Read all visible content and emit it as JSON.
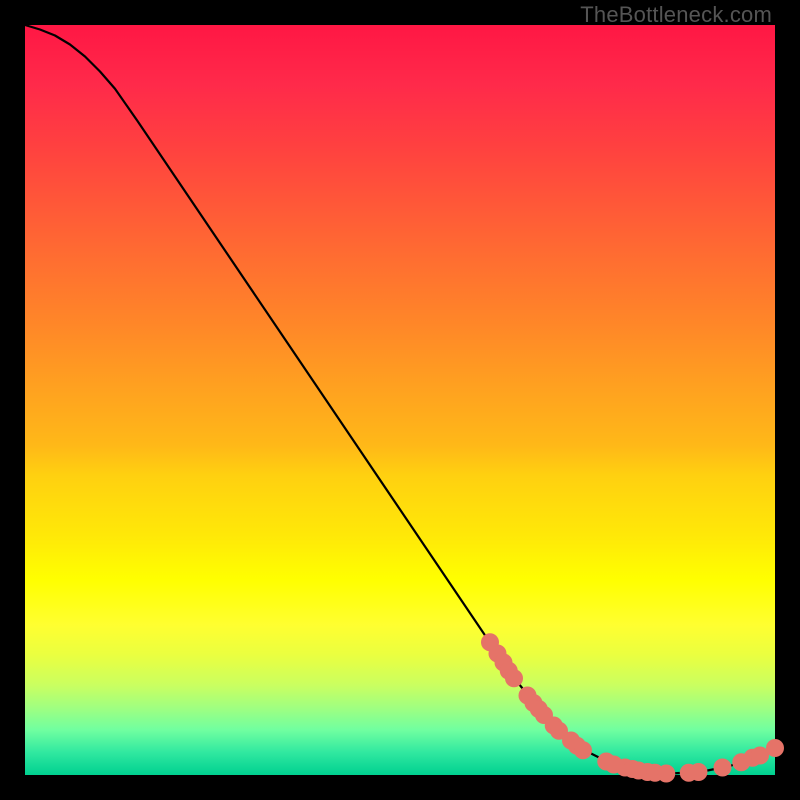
{
  "watermark": "TheBottleneck.com",
  "chart_data": {
    "type": "line",
    "title": "",
    "xlabel": "",
    "ylabel": "",
    "xlim": [
      0,
      100
    ],
    "ylim": [
      0,
      100
    ],
    "grid": false,
    "curve": [
      {
        "x": 0.0,
        "y": 100.0
      },
      {
        "x": 2.0,
        "y": 99.4
      },
      {
        "x": 4.0,
        "y": 98.6
      },
      {
        "x": 6.0,
        "y": 97.4
      },
      {
        "x": 8.0,
        "y": 95.8
      },
      {
        "x": 10.0,
        "y": 93.8
      },
      {
        "x": 12.0,
        "y": 91.5
      },
      {
        "x": 15.0,
        "y": 87.2
      },
      {
        "x": 20.0,
        "y": 79.8
      },
      {
        "x": 25.0,
        "y": 72.4
      },
      {
        "x": 30.0,
        "y": 65.0
      },
      {
        "x": 35.0,
        "y": 57.6
      },
      {
        "x": 40.0,
        "y": 50.2
      },
      {
        "x": 45.0,
        "y": 42.8
      },
      {
        "x": 50.0,
        "y": 35.4
      },
      {
        "x": 55.0,
        "y": 28.0
      },
      {
        "x": 60.0,
        "y": 20.6
      },
      {
        "x": 65.0,
        "y": 13.2
      },
      {
        "x": 70.0,
        "y": 7.0
      },
      {
        "x": 74.0,
        "y": 3.6
      },
      {
        "x": 78.0,
        "y": 1.6
      },
      {
        "x": 82.0,
        "y": 0.6
      },
      {
        "x": 86.0,
        "y": 0.2
      },
      {
        "x": 90.0,
        "y": 0.4
      },
      {
        "x": 94.0,
        "y": 1.2
      },
      {
        "x": 98.0,
        "y": 2.6
      },
      {
        "x": 100.0,
        "y": 3.6
      }
    ],
    "highlight_points": [
      {
        "x": 62.0,
        "y": 17.7
      },
      {
        "x": 63.0,
        "y": 16.2
      },
      {
        "x": 63.8,
        "y": 15.0
      },
      {
        "x": 64.5,
        "y": 13.9
      },
      {
        "x": 65.2,
        "y": 12.9
      },
      {
        "x": 67.0,
        "y": 10.6
      },
      {
        "x": 67.8,
        "y": 9.6
      },
      {
        "x": 68.5,
        "y": 8.8
      },
      {
        "x": 69.2,
        "y": 8.0
      },
      {
        "x": 70.5,
        "y": 6.6
      },
      {
        "x": 71.2,
        "y": 5.9
      },
      {
        "x": 72.8,
        "y": 4.6
      },
      {
        "x": 73.6,
        "y": 3.9
      },
      {
        "x": 74.4,
        "y": 3.3
      },
      {
        "x": 77.5,
        "y": 1.8
      },
      {
        "x": 78.5,
        "y": 1.4
      },
      {
        "x": 80.0,
        "y": 1.0
      },
      {
        "x": 81.0,
        "y": 0.8
      },
      {
        "x": 81.8,
        "y": 0.6
      },
      {
        "x": 83.0,
        "y": 0.4
      },
      {
        "x": 84.0,
        "y": 0.3
      },
      {
        "x": 85.5,
        "y": 0.2
      },
      {
        "x": 88.5,
        "y": 0.3
      },
      {
        "x": 89.8,
        "y": 0.4
      },
      {
        "x": 93.0,
        "y": 1.0
      },
      {
        "x": 95.5,
        "y": 1.7
      },
      {
        "x": 97.0,
        "y": 2.3
      },
      {
        "x": 98.0,
        "y": 2.6
      },
      {
        "x": 100.0,
        "y": 3.6
      }
    ],
    "curve_color": "#000000",
    "point_color": "#e57368",
    "point_radius": 9
  }
}
